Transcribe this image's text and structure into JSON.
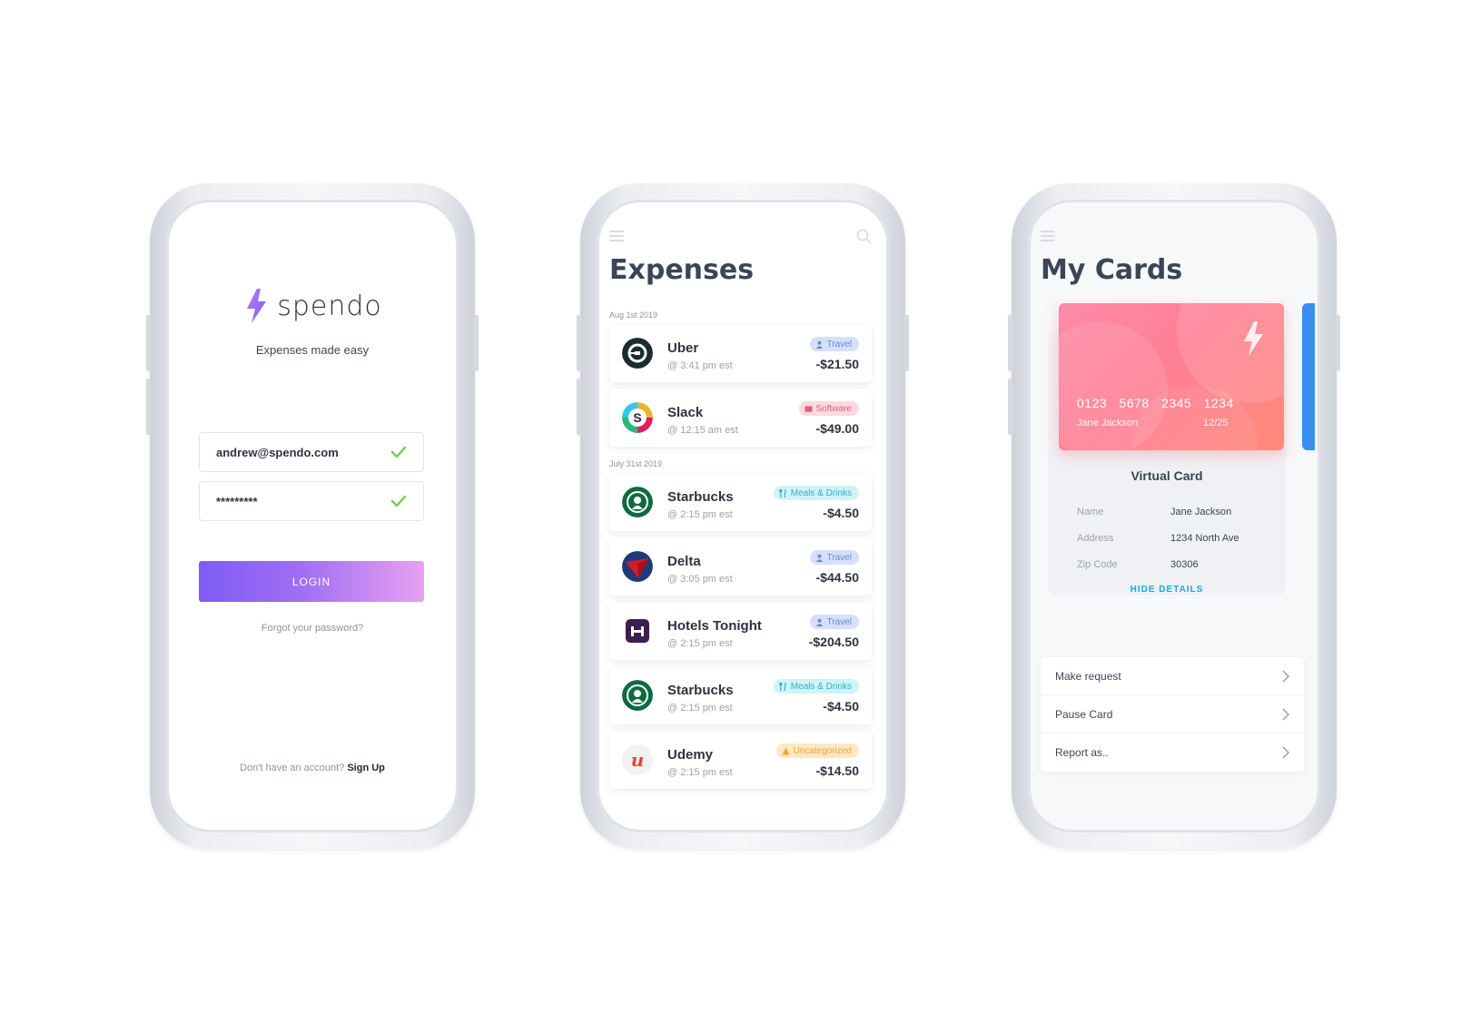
{
  "login": {
    "brand": "spendo",
    "tagline": "Expenses made easy",
    "email_value": "andrew@spendo.com",
    "password_value": "*********",
    "login_label": "LOGIN",
    "forgot_label": "Forgot your password?",
    "no_account_text": "Don't have an account?",
    "signup_label": "Sign Up"
  },
  "expenses": {
    "title": "Expenses",
    "groups": [
      {
        "date": "Aug 1st 2019",
        "items": [
          {
            "merchant": "Uber",
            "time": "@ 3:41 pm est",
            "tag": "Travel",
            "tag_type": "travel",
            "amount": "-$21.50",
            "logo": "uber-logo"
          },
          {
            "merchant": "Slack",
            "time": "@ 12:15 am est",
            "tag": "Software",
            "tag_type": "software",
            "amount": "-$49.00",
            "logo": "slack-logo"
          }
        ]
      },
      {
        "date": "July 31st 2019",
        "items": [
          {
            "merchant": "Starbucks",
            "time": "@ 2:15 pm est",
            "tag": "Meals & Drinks",
            "tag_type": "meals",
            "amount": "-$4.50",
            "logo": "starbucks-logo"
          },
          {
            "merchant": "Delta",
            "time": "@ 3:05 pm est",
            "tag": "Travel",
            "tag_type": "travel",
            "amount": "-$44.50",
            "logo": "delta-logo"
          },
          {
            "merchant": "Hotels Tonight",
            "time": "@ 2:15 pm est",
            "tag": "Travel",
            "tag_type": "travel",
            "amount": "-$204.50",
            "logo": "hotels-tonight-logo"
          },
          {
            "merchant": "Starbucks",
            "time": "@ 2:15 pm est",
            "tag": "Meals & Drinks",
            "tag_type": "meals",
            "amount": "-$4.50",
            "logo": "starbucks-logo"
          },
          {
            "merchant": "Udemy",
            "time": "@ 2:15 pm est",
            "tag": "Uncategorized",
            "tag_type": "uncat",
            "amount": "-$14.50",
            "logo": "udemy-logo"
          }
        ]
      }
    ]
  },
  "cards": {
    "title": "My Cards",
    "card_number": "0123 5678 2345 1234",
    "card_holder": "Jane Jackson",
    "card_expiry": "12/25",
    "card_title": "Virtual Card",
    "details": [
      {
        "key": "Name",
        "value": "Jane Jackson"
      },
      {
        "key": "Address",
        "value": "1234 North Ave"
      },
      {
        "key": "Zip Code",
        "value": "30306"
      }
    ],
    "hide_details_label": "HIDE DETAILS",
    "actions": [
      "Make request",
      "Pause Card",
      "Report as.."
    ]
  },
  "colors": {
    "accent_purple": "#7e5cf5",
    "accent_pink": "#ff7f95",
    "link_blue": "#19a9e0",
    "check_green": "#7ac943"
  },
  "icons": [
    "spendo-bolt-logo",
    "check-icon",
    "menu-icon",
    "search-icon",
    "chevron-right-icon",
    "person-icon",
    "software-icon",
    "meals-icon",
    "warning-icon"
  ]
}
